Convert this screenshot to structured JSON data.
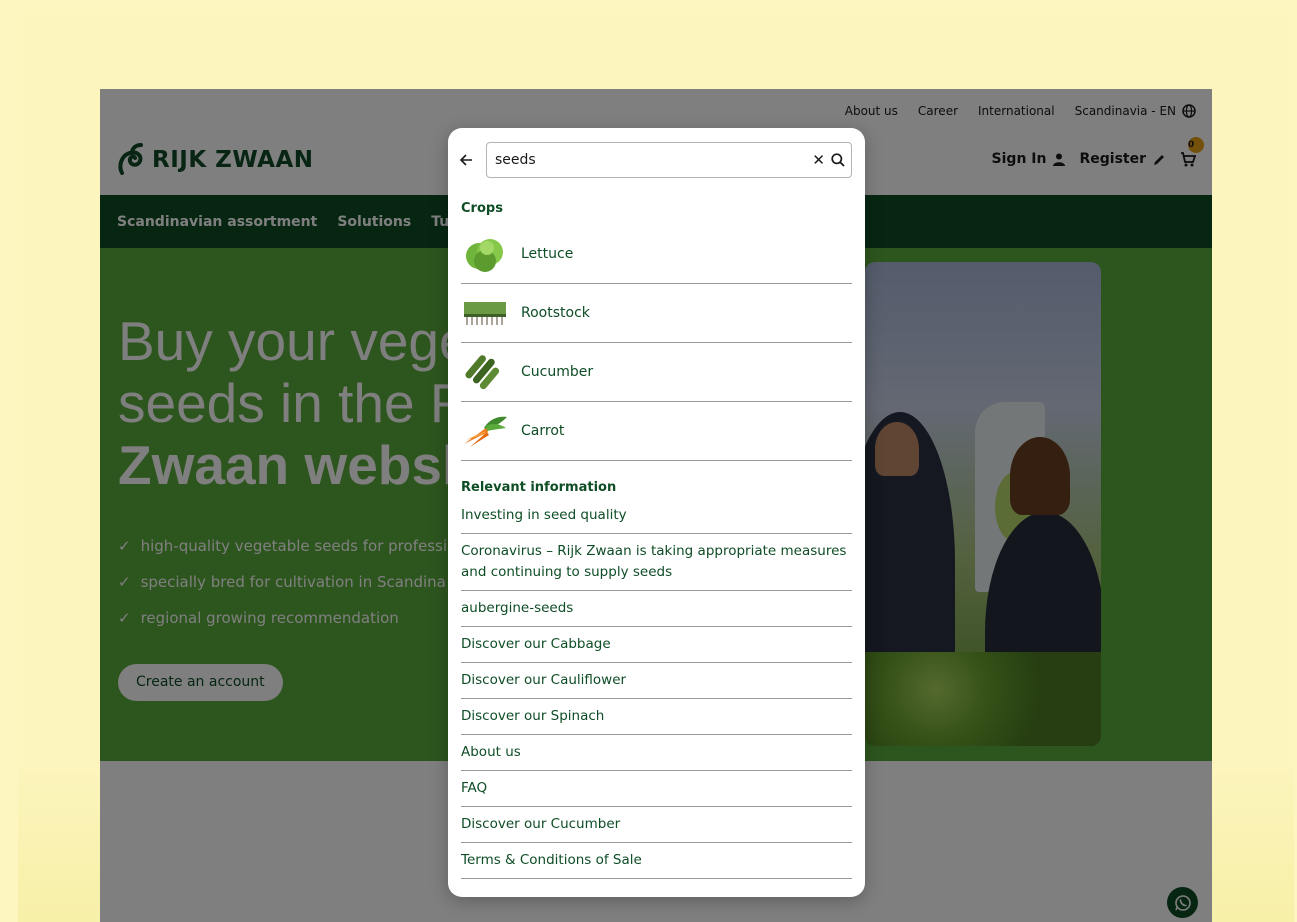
{
  "site": {
    "top_links": [
      "About us",
      "Career",
      "International",
      "Scandinavia - EN"
    ],
    "logo_text": "RIJK ZWAAN",
    "sign_in": "Sign In",
    "register": "Register",
    "cart_count": "0",
    "nav": [
      "Scandinavian assortment",
      "Solutions",
      "Tutorials"
    ],
    "hero": {
      "title_line1": "Buy your vege",
      "title_line2": "seeds in the R",
      "title_line3": "Zwaan websh",
      "bullets": [
        "high-quality vegetable seeds for professi",
        "specially bred for cultivation in Scandina",
        "regional growing recommendation"
      ],
      "cta": "Create an account"
    }
  },
  "search": {
    "query": "seeds",
    "crops_heading": "Crops",
    "crops": [
      {
        "label": "Lettuce",
        "icon": "lettuce-icon"
      },
      {
        "label": "Rootstock",
        "icon": "rootstock-icon"
      },
      {
        "label": "Cucumber",
        "icon": "cucumber-icon"
      },
      {
        "label": "Carrot",
        "icon": "carrot-icon"
      }
    ],
    "info_heading": "Relevant information",
    "info": [
      "Investing in seed quality",
      "Coronavirus – Rijk Zwaan is taking appropriate measures and continuing to supply seeds",
      "aubergine-seeds",
      "Discover our Cabbage",
      "Discover our Cauliflower",
      "Discover our Spinach",
      "About us",
      "FAQ",
      "Discover our Cucumber",
      "Terms & Conditions of Sale"
    ]
  },
  "colors": {
    "brand_green": "#0e4d25",
    "hero_green": "#5bab3c",
    "background": "#fcf5bd",
    "badge": "#e8a317"
  }
}
